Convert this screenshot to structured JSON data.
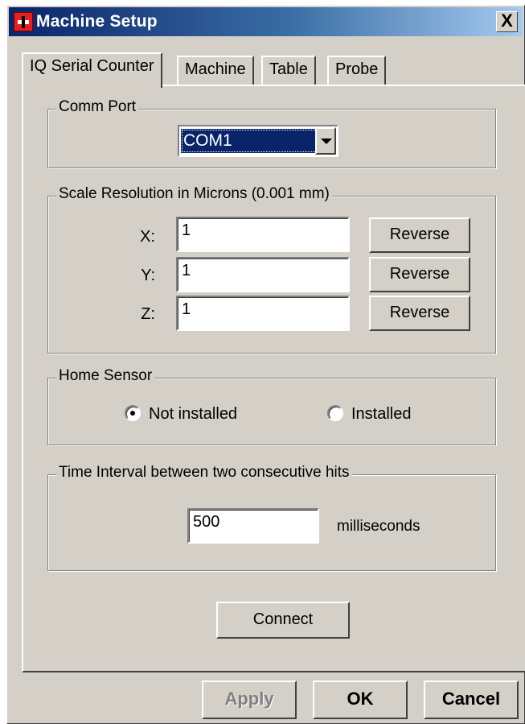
{
  "window": {
    "title": "Machine Setup",
    "close_glyph": "X",
    "icon": "app-icon"
  },
  "tabs": [
    {
      "label": "IQ Serial Counter",
      "active": true
    },
    {
      "label": "Machine",
      "active": false
    },
    {
      "label": "Table",
      "active": false
    },
    {
      "label": "Probe",
      "active": false
    }
  ],
  "comm_port": {
    "legend": "Comm Port",
    "selected": "COM1"
  },
  "scale_resolution": {
    "legend": "Scale Resolution in Microns (0.001 mm)",
    "axes": [
      {
        "label": "X:",
        "value": "1",
        "button": "Reverse"
      },
      {
        "label": "Y:",
        "value": "1",
        "button": "Reverse"
      },
      {
        "label": "Z:",
        "value": "1",
        "button": "Reverse"
      }
    ]
  },
  "home_sensor": {
    "legend": "Home Sensor",
    "options": [
      {
        "label": "Not installed",
        "checked": true
      },
      {
        "label": "Installed",
        "checked": false
      }
    ]
  },
  "time_interval": {
    "legend": "Time Interval between two consecutive hits",
    "value": "500",
    "unit": "milliseconds"
  },
  "connect_label": "Connect",
  "footer": {
    "apply_label": "Apply",
    "apply_enabled": false,
    "ok_label": "OK",
    "cancel_label": "Cancel"
  },
  "colors": {
    "dialog_face": "#d4d0c8",
    "titlebar_start": "#0a246a",
    "titlebar_end": "#a6caf0",
    "selection": "#0a246a"
  }
}
